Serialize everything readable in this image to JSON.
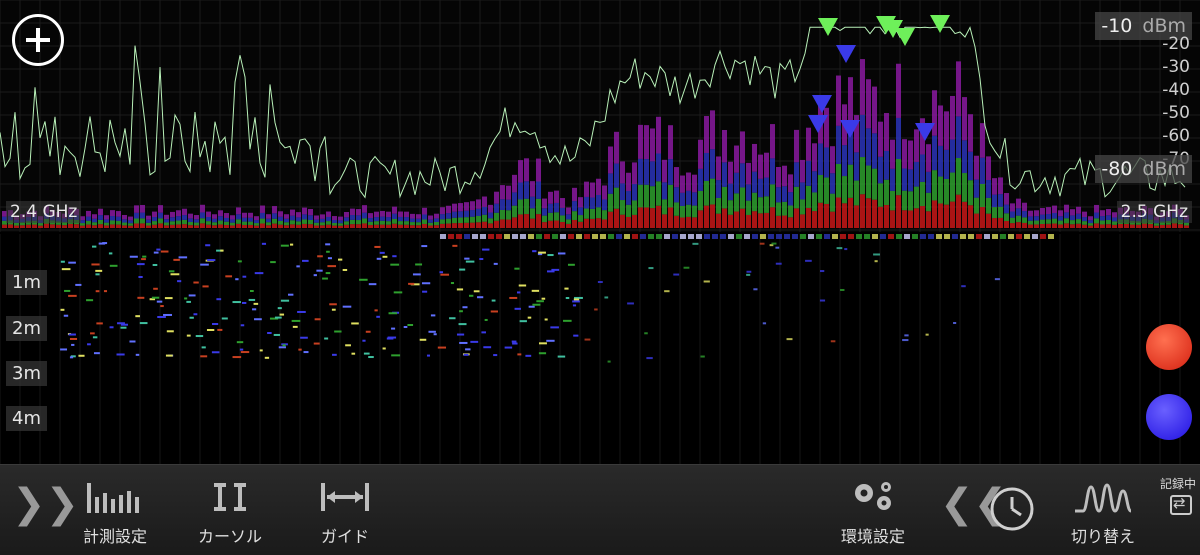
{
  "spectrum": {
    "freq_start_label": "2.4 GHz",
    "freq_end_label": "2.5 GHz",
    "db_top_value": "-10",
    "db_unit": "dBm",
    "db_bottom_value": "-80",
    "db_scale": [
      "-20",
      "-30",
      "-40",
      "-50",
      "-60",
      "-70"
    ],
    "add_icon": "plus-circle-icon"
  },
  "waterfall": {
    "time_labels": [
      "1m",
      "2m",
      "3m",
      "4m"
    ],
    "marker_colors": {
      "red": "#e8301c",
      "blue": "#2a1cf0"
    }
  },
  "toolbar": {
    "expand_icon": "double-chevron-right-icon",
    "measure_settings_label": "計測設定",
    "cursor_label": "カーソル",
    "guide_label": "ガイド",
    "env_settings_label": "環境設定",
    "collapse_icon": "double-chevron-left-icon",
    "switch_label": "切り替え",
    "recording_label": "記録中"
  },
  "colors": {
    "trace": "#b8f0b8",
    "peak_marker": "#6ef05a",
    "min_marker": "#3a3ae8",
    "band_red": "#c81818",
    "band_green": "#2ea02e",
    "band_blue": "#2a34b8",
    "band_purple": "#8a1aa0"
  }
}
